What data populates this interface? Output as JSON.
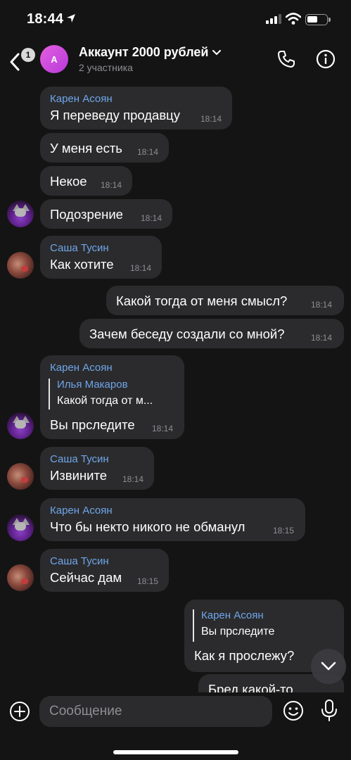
{
  "status_bar": {
    "time": "18:44"
  },
  "header": {
    "back_badge": "1",
    "avatar_letter": "А",
    "title": "Аккаунт 2000 рублей",
    "subtitle": "2 участника"
  },
  "messages": [
    {
      "author": "Карен Асоян",
      "text": "Я переведу продавцу",
      "time": "18:14"
    },
    {
      "text": "У меня есть",
      "time": "18:14"
    },
    {
      "text": "Некое",
      "time": "18:14"
    },
    {
      "text": "Подозрение",
      "time": "18:14"
    },
    {
      "author": "Саша Тусин",
      "text": "Как хотите",
      "time": "18:14"
    },
    {
      "text": "Какой тогда от меня смысл?",
      "time": "18:14"
    },
    {
      "text": "Зачем беседу создали со мной?",
      "time": "18:14"
    },
    {
      "author": "Карен Асоян",
      "reply_author": "Илья Макаров",
      "reply_text": "Какой тогда от м...",
      "text": "Вы прследите",
      "time": "18:14"
    },
    {
      "author": "Саша Тусин",
      "text": "Извините",
      "time": "18:14"
    },
    {
      "author": "Карен Асоян",
      "text": "Что бы некто никого не обманул",
      "time": "18:15"
    },
    {
      "author": "Саша Тусин",
      "text": "Сейчас дам",
      "time": "18:15"
    },
    {
      "reply_author": "Карен Асоян",
      "reply_text": "Вы прследите",
      "text": "Как я прослежу?",
      "time": ""
    },
    {
      "text": "Бред какой-то",
      "time": ""
    }
  ],
  "composer": {
    "placeholder": "Сообщение"
  },
  "colors": {
    "author": "#6fa6ea",
    "bubble": "#2b2b2d",
    "background": "#141414",
    "avatar_gradient": "#d84fdc"
  }
}
